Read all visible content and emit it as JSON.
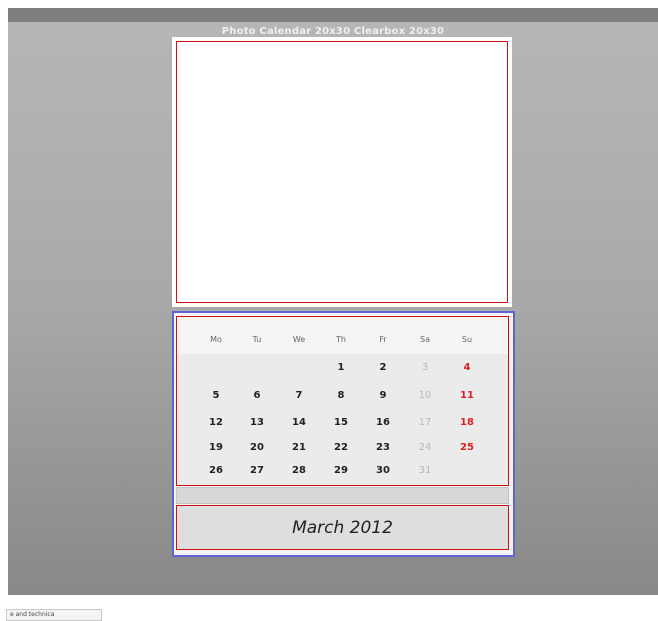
{
  "page": {
    "title": "Photo Calendar 20x30 Clearbox 20x30"
  },
  "calendar": {
    "weekdays": [
      "Mo",
      "Tu",
      "We",
      "Th",
      "Fr",
      "Sa",
      "Su"
    ],
    "weeks": [
      [
        "",
        "",
        "",
        "1",
        "2",
        "3",
        "4"
      ],
      [
        "5",
        "6",
        "7",
        "8",
        "9",
        "10",
        "11"
      ],
      [
        "12",
        "13",
        "14",
        "15",
        "16",
        "17",
        "18"
      ],
      [
        "19",
        "20",
        "21",
        "22",
        "23",
        "24",
        "25"
      ],
      [
        "26",
        "27",
        "28",
        "29",
        "30",
        "31",
        ""
      ]
    ],
    "month_label": "March 2012"
  },
  "footer": {
    "tab_label": "e and technica"
  },
  "colors": {
    "frame_border": "#d01010",
    "calendar_border": "#6262d8",
    "sunday": "#e02020",
    "saturday": "#b8b8b8"
  }
}
